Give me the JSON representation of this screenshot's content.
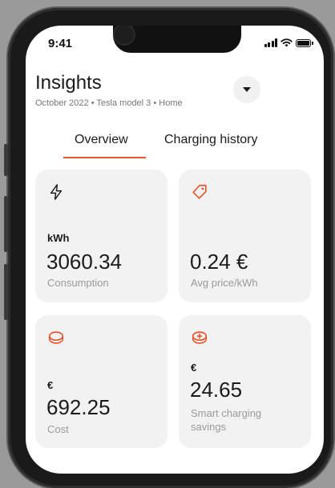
{
  "status_bar": {
    "time": "9:41"
  },
  "header": {
    "title": "Insights",
    "subtitle": "October 2022 • Tesla model 3 • Home"
  },
  "tabs": [
    {
      "label": "Overview",
      "active": true
    },
    {
      "label": "Charging history",
      "active": false
    }
  ],
  "cards": [
    {
      "icon": "lightning-icon",
      "unit": "kWh",
      "value": "3060.34",
      "label": "Consumption"
    },
    {
      "icon": "price-tag-icon",
      "unit": "",
      "value": "0.24 €",
      "label": "Avg price/kWh"
    },
    {
      "icon": "coins-icon",
      "unit": "€",
      "value": "692.25",
      "label": "Cost"
    },
    {
      "icon": "coin-plus-icon",
      "unit": "€",
      "value": "24.65",
      "label": "Smart charging savings"
    }
  ],
  "colors": {
    "accent": "#e4572e",
    "card_bg": "#f2f2f2",
    "muted_text": "#9a9a9a"
  }
}
